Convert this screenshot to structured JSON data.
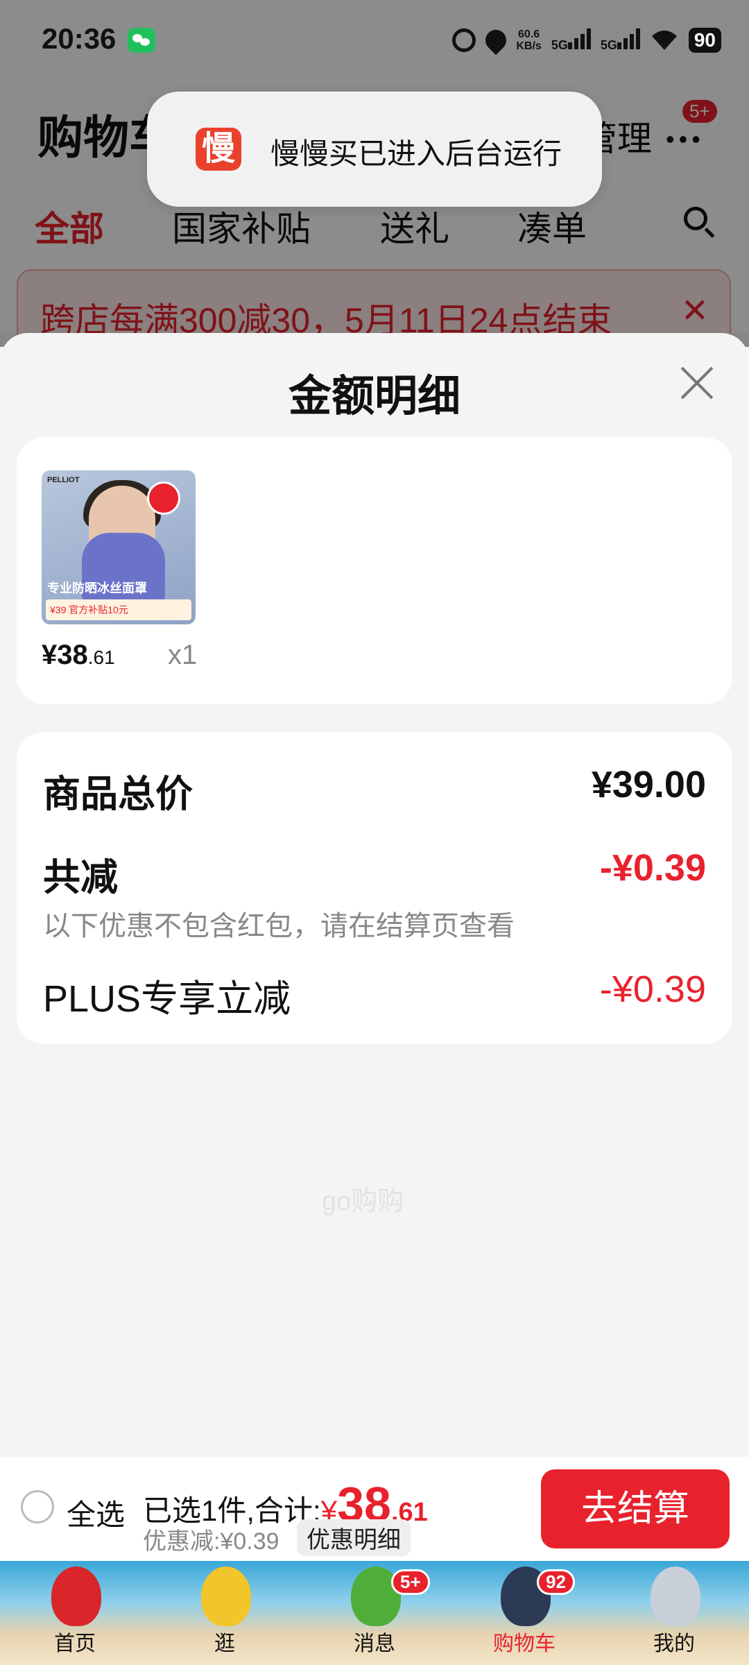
{
  "status_bar": {
    "time": "20:36",
    "net_speed_value": "60.6",
    "net_speed_unit": "KB/s",
    "signal1": "5G",
    "signal2": "5G",
    "battery": "90",
    "icons": [
      "wechat-icon",
      "alarm-icon",
      "location-icon",
      "signal-icon",
      "wifi-icon",
      "battery-icon"
    ]
  },
  "background_page": {
    "title": "购物车",
    "manage": "管理",
    "msg_badge": "5+",
    "tabs": [
      "全部",
      "国家补贴",
      "送礼",
      "凑单"
    ],
    "promo": "跨店每满300减30，5月11日24点结束"
  },
  "toast": {
    "app_icon_text": "慢",
    "text": "慢慢买已进入后台运行"
  },
  "sheet": {
    "title": "金额明细",
    "product": {
      "thumb_brand": "PELLIOT",
      "thumb_caption": "专业防晒冰丝面罩",
      "thumb_strip": "¥39 官方补贴10元",
      "price_main": "¥38",
      "price_dec": ".61",
      "qty": "x1"
    },
    "summary": {
      "total_label": "商品总价",
      "total_value": "¥39.00",
      "reduce_label": "共减",
      "reduce_value": "-¥0.39",
      "reduce_note": "以下优惠不包含红包，请在结算页查看",
      "plus_label": "PLUS专享立减",
      "plus_value": "-¥0.39",
      "watermark": "go购购"
    }
  },
  "bottom_bar": {
    "select_all": "全选",
    "selected_prefix": "已选1件,合计:",
    "currency": "¥",
    "total_int": "38",
    "total_dec": ".61",
    "discount": "优惠减:¥0.39",
    "detail_button": "优惠明细",
    "checkout": "去结算"
  },
  "nav": [
    {
      "label": "首页",
      "badge": "",
      "active": false,
      "color": "#d8262b"
    },
    {
      "label": "逛",
      "badge": "",
      "active": false,
      "color": "#f2c52a"
    },
    {
      "label": "消息",
      "badge": "5+",
      "active": false,
      "color": "#4fae3a"
    },
    {
      "label": "购物车",
      "badge": "92",
      "active": true,
      "color": "#2d3a55"
    },
    {
      "label": "我的",
      "badge": "",
      "active": false,
      "color": "#c9cfd8"
    }
  ]
}
